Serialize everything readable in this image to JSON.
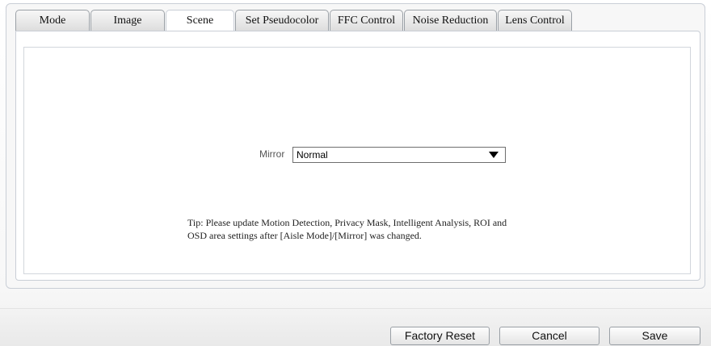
{
  "tabs": [
    {
      "label": "Mode"
    },
    {
      "label": "Image"
    },
    {
      "label": "Scene",
      "active": true
    },
    {
      "label": "Set Pseudocolor"
    },
    {
      "label": "FFC Control"
    },
    {
      "label": "Noise Reduction"
    },
    {
      "label": "Lens Control"
    }
  ],
  "scene": {
    "mirror_label": "Mirror",
    "mirror_value": "Normal",
    "tip": "Tip: Please update Motion Detection, Privacy Mask, Intelligent Analysis, ROI and OSD area settings after [Aisle Mode]/[Mirror] was changed."
  },
  "footer": {
    "factory_reset_label": "Factory Reset",
    "cancel_label": "Cancel",
    "save_label": "Save"
  },
  "colors": {
    "border": "#c9ced6",
    "tab_gradient_top": "#f7f7f7",
    "tab_gradient_bottom": "#dcdcdc"
  }
}
